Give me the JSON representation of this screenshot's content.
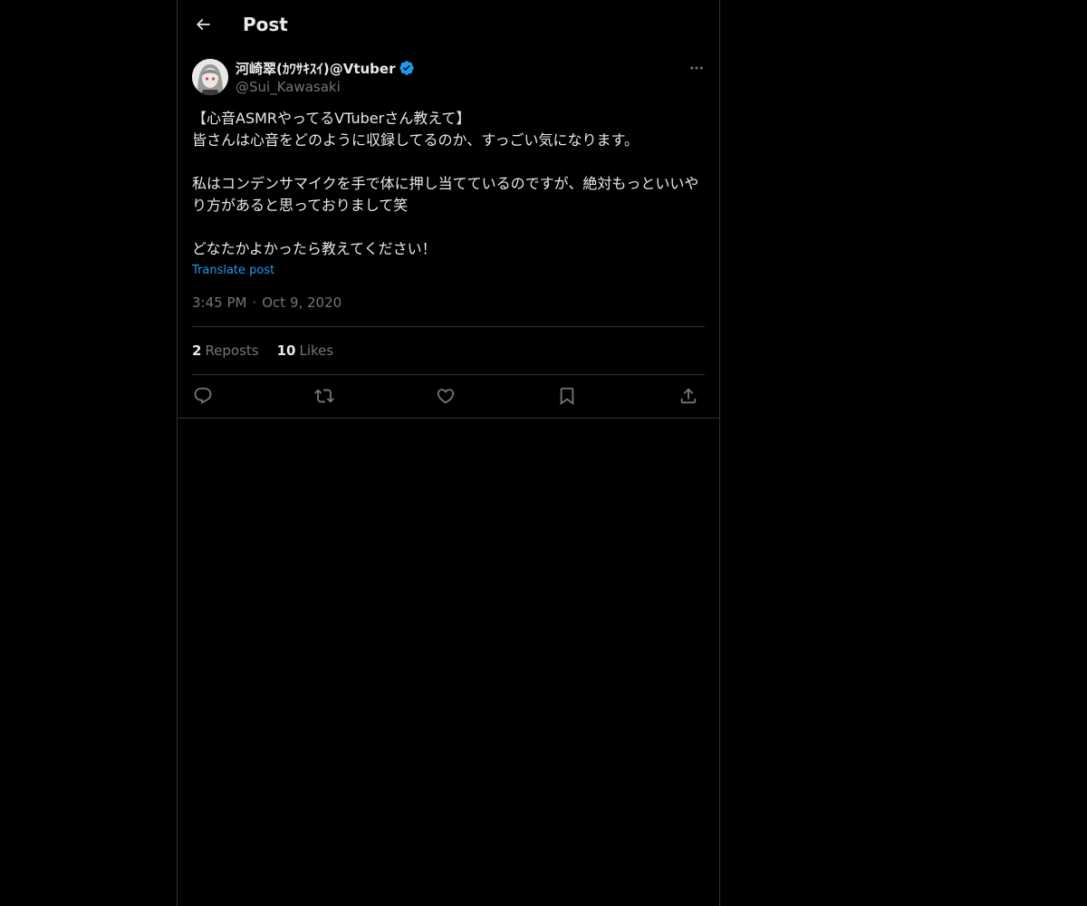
{
  "header": {
    "back_icon": "arrow-left-icon",
    "title": "Post"
  },
  "author": {
    "display_name": "河崎翠(ｶﾜｻｷｽｲ)@Vtuber",
    "handle": "@Sui_Kawasaki",
    "verified": true,
    "verified_color": "#1d9bf0"
  },
  "post": {
    "text": "【心音ASMRやってるVTuberさん教えて】\n皆さんは心音をどのように収録してるのか、すっごい気になります。\n\n私はコンデンサマイクを手で体に押し当てているのですが、絶対もっといいやり方があると思っておりまして笑\n\nどなたかよかったら教えてください！",
    "translate_label": "Translate post",
    "time": "3:45 PM",
    "separator": "·",
    "date": "Oct 9, 2020"
  },
  "stats": {
    "reposts_count": "2",
    "reposts_label": "Reposts",
    "likes_count": "10",
    "likes_label": "Likes"
  },
  "actions": [
    "reply-icon",
    "repost-icon",
    "like-icon",
    "bookmark-icon",
    "share-icon"
  ],
  "colors": {
    "background": "#000000",
    "text": "#e7e9ea",
    "secondary": "#71767b",
    "border": "#2f3336",
    "accent": "#1d9bf0"
  }
}
